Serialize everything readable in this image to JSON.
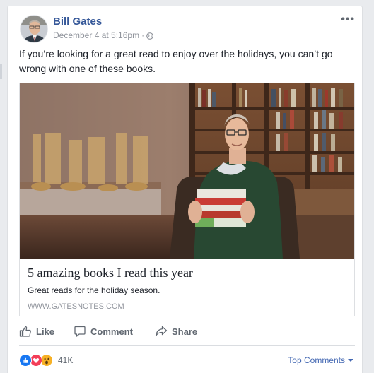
{
  "post": {
    "author": "Bill Gates",
    "timestamp": "December 4 at 5:16pm",
    "separator": "·",
    "privacy_icon": "globe-icon",
    "text": "If you’re looking for a great read to enjoy over the holidays, you can’t go wrong with one of these books."
  },
  "link": {
    "title": "5 amazing books I read this year",
    "description": "Great reads for the holiday season.",
    "domain": "www.gatesnotes.com"
  },
  "actions": {
    "like": "Like",
    "comment": "Comment",
    "share": "Share"
  },
  "footer": {
    "reaction_count": "41K",
    "reactions": [
      "like",
      "love",
      "wow"
    ],
    "sort_label": "Top Comments"
  },
  "colors": {
    "author": "#365899",
    "link_blue": "#4267b2",
    "like_blue": "#1877f2",
    "love_red": "#f33e58",
    "wow_yellow": "#f7b125"
  }
}
